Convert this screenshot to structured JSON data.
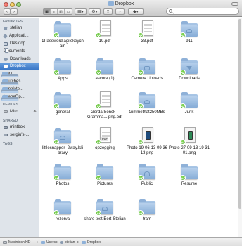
{
  "window": {
    "title": "Dropbox"
  },
  "search": {
    "placeholder": ""
  },
  "sidebar": {
    "favorites_header": "FAVORITES",
    "devices_header": "DEVICES",
    "shared_header": "SHARED",
    "tags_header": "TAGS",
    "favorites": [
      {
        "label": "stelian",
        "icon": "home-icon"
      },
      {
        "label": "Applicati...",
        "icon": "applications-icon"
      },
      {
        "label": "Desktop",
        "icon": "desktop-icon"
      },
      {
        "label": "Documents",
        "icon": "documents-icon"
      },
      {
        "label": "Downloads",
        "icon": "downloads-icon"
      },
      {
        "label": "Dropbox",
        "icon": "dropbox-icon"
      },
      {
        "label": "work",
        "icon": "folder-icon"
      },
      {
        "label": "churches",
        "icon": "folder-icon"
      },
      {
        "label": "template...",
        "icon": "folder-icon"
      },
      {
        "label": "ImageOp...",
        "icon": "folder-icon"
      }
    ],
    "devices": [
      {
        "label": "Miro",
        "icon": "disk-icon"
      }
    ],
    "shared": [
      {
        "label": "mintbox",
        "icon": "computer-icon"
      },
      {
        "label": "sergiu's-...",
        "icon": "computer-icon"
      }
    ]
  },
  "files": [
    {
      "label": "1Password.agilekeychain",
      "icon": "folder-icon"
    },
    {
      "label": "19.pdf",
      "icon": "document-icon"
    },
    {
      "label": "33.pdf",
      "icon": "document-icon"
    },
    {
      "label": "911",
      "icon": "folder-icon"
    },
    {
      "label": "Apps",
      "icon": "folder-icon"
    },
    {
      "label": "ascore (1)",
      "icon": "folder-icon"
    },
    {
      "label": "Camera Uploads",
      "icon": "camera-folder-icon"
    },
    {
      "label": "Downloads",
      "icon": "downloads-folder-icon"
    },
    {
      "label": "general",
      "icon": "folder-icon"
    },
    {
      "label": "Gerda Sonck – Gramma....png.pdf",
      "icon": "pdf-icon"
    },
    {
      "label": "Gimmethat250MBs",
      "icon": "shared-folder-icon"
    },
    {
      "label": "Junk",
      "icon": "folder-icon"
    },
    {
      "label": "littlesnapper_2way.lslibrary",
      "icon": "shared-folder-icon"
    },
    {
      "label": "opzegging",
      "icon": "pdf-icon"
    },
    {
      "label": "Photo 19-06-13 09 36 13.png",
      "icon": "image-icon"
    },
    {
      "label": "Photo 27-09-13 19 31 01.png",
      "icon": "image-icon"
    },
    {
      "label": "Photos",
      "icon": "folder-icon"
    },
    {
      "label": "Pictures",
      "icon": "folder-icon"
    },
    {
      "label": "Public",
      "icon": "public-folder-icon"
    },
    {
      "label": "Resurse",
      "icon": "folder-icon"
    },
    {
      "label": "rezerva",
      "icon": "folder-icon"
    },
    {
      "label": "share test Bert-Stelian",
      "icon": "shared-folder-icon"
    },
    {
      "label": "tram",
      "icon": "folder-icon"
    }
  ],
  "pathbar": [
    "Macintosh HD",
    "Users",
    "stelian",
    "Dropbox"
  ]
}
